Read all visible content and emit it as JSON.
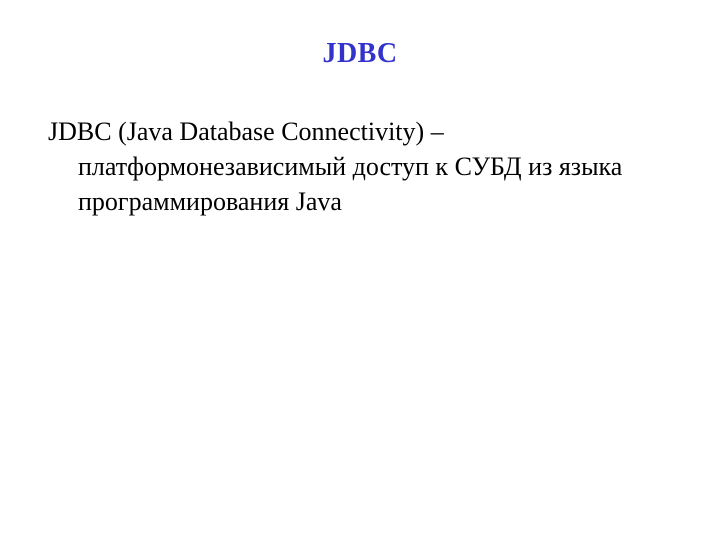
{
  "slide": {
    "title": "JDBC",
    "body": "JDBC (Java Database Connectivity) – платформонезависимый доступ к СУБД из языка программирования Java"
  }
}
